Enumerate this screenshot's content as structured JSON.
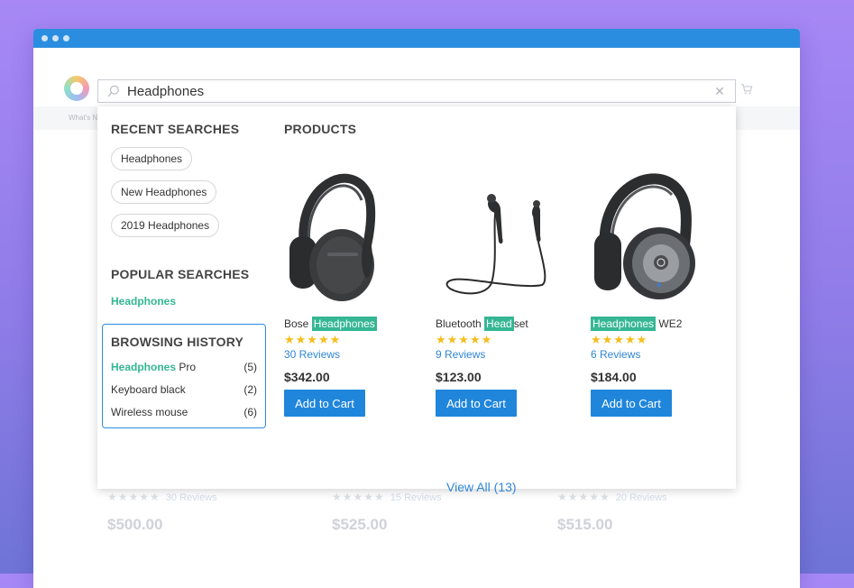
{
  "search": {
    "value": "Headphones",
    "placeholder": ""
  },
  "subnav": {
    "text": "What's N"
  },
  "recent": {
    "title": "RECENT SEARCHES",
    "items": [
      "Headphones",
      "New Headphones",
      "2019 Headphones"
    ]
  },
  "popular": {
    "title": "POPULAR SEARCHES",
    "items": [
      "Headphones"
    ]
  },
  "history": {
    "title": "BROWSING HISTORY",
    "items": [
      {
        "highlight": "Headphones",
        "rest": " Pro",
        "count": "(5)"
      },
      {
        "highlight": "",
        "rest": "Keyboard black",
        "count": "(2)"
      },
      {
        "highlight": "",
        "rest": "Wireless mouse",
        "count": "(6)"
      }
    ]
  },
  "products": {
    "title": "PRODUCTS",
    "items": [
      {
        "pre": "Bose ",
        "hl": "Headphones",
        "post": "",
        "stars": "★★★★★",
        "reviews": "30 Reviews",
        "price": "$342.00",
        "button": "Add to Cart"
      },
      {
        "pre": "Bluetooth ",
        "hl": "Head",
        "post": "set",
        "stars": "★★★★★",
        "reviews": "9 Reviews",
        "price": "$123.00",
        "button": "Add to Cart"
      },
      {
        "pre": "",
        "hl": "Headphones",
        "post": " WE2",
        "stars": "★★★★★",
        "reviews": "6 Reviews",
        "price": "$184.00",
        "button": "Add to Cart"
      }
    ],
    "view_all": "View All (13)"
  },
  "background_products": [
    {
      "stars": "★★★★★",
      "reviews": "30 Reviews",
      "price": "$500.00"
    },
    {
      "stars": "★★★★★",
      "reviews": "15 Reviews",
      "price": "$525.00"
    },
    {
      "stars": "★★★★★",
      "reviews": "20 Reviews",
      "price": "$515.00"
    }
  ],
  "colors": {
    "accent": "#1f86dc",
    "highlight": "#35b694",
    "star": "#f5be1e"
  }
}
